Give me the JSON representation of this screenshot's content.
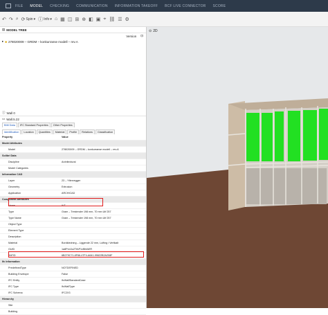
{
  "topbar": {
    "items": [
      {
        "label": "FILE"
      },
      {
        "label": "MODEL"
      },
      {
        "label": "CHECKING"
      },
      {
        "label": "COMMUNICATION"
      },
      {
        "label": "INFORMATION TAKEOFF"
      },
      {
        "label": "BCF LIVE CONNECTOR"
      },
      {
        "label": "SCORE"
      }
    ],
    "active": "MODEL"
  },
  "toolbar": {
    "spin_label": "Spin",
    "info_label": "Info"
  },
  "model_tree": {
    "title": "MODEL TREE",
    "column_header": "Version",
    "file_name": "278020009 – GRDM – konkurranse modell – rev.A"
  },
  "view_2d": {
    "label": "2D"
  },
  "props": {
    "header_label": "Wall 0",
    "title": "Wall.5.22",
    "tabs": [
      "BIM Data",
      "IFC Standard Properties",
      "Other Properties"
    ],
    "subtabs": [
      "Identification",
      "Location",
      "Quantities",
      "Material",
      "Profile",
      "Relations",
      "Classification"
    ],
    "col_property": "Property",
    "col_value": "Value"
  },
  "rows": [
    {
      "k": "Model Attributes",
      "v": "",
      "type": "sec"
    },
    {
      "k": "Model",
      "v": "278020009 – GRDM – konkurranse modell – rev.A",
      "type": "row"
    },
    {
      "k": "Solibri Data",
      "v": "",
      "type": "sec"
    },
    {
      "k": "Discipline",
      "v": "Architectural",
      "type": "row"
    },
    {
      "k": "Model Categories",
      "v": "",
      "type": "row"
    },
    {
      "k": "Information CAD",
      "v": "",
      "type": "sec"
    },
    {
      "k": "Layer",
      "v": "23 – Yttervegger",
      "type": "row"
    },
    {
      "k": "Geometry",
      "v": "Extrusion",
      "type": "row"
    },
    {
      "k": "Application",
      "v": "ARCHICAD",
      "type": "row"
    },
    {
      "k": "Component Attributes",
      "v": "",
      "type": "sec"
    },
    {
      "k": "Name",
      "v": "IVT-",
      "type": "row"
    },
    {
      "k": "Type",
      "v": "Gram – Trestender 198 mm, 70 mm Utf 257",
      "type": "row"
    },
    {
      "k": "Type Name",
      "v": "Gram – Trestender 198 mm, 70 mm Utf 257",
      "type": "row"
    },
    {
      "k": "Object Type",
      "v": "",
      "type": "row"
    },
    {
      "k": "Element Type",
      "v": "",
      "type": "row"
    },
    {
      "k": "Description",
      "v": "",
      "type": "row"
    },
    {
      "k": "Material",
      "v": "Bordkledning – Liggende 22 mm, Lufting i Vertikalt",
      "type": "row"
    },
    {
      "k": "GUID",
      "v": "1a8Pnn3u2TfAP1xBMAER",
      "type": "row"
    },
    {
      "k": "BATID",
      "v": "6B279C71-8F66-47F4-A641-99622B2A208F",
      "type": "row"
    },
    {
      "k": "Ifc Information",
      "v": "",
      "type": "sec"
    },
    {
      "k": "PredefinedType",
      "v": "NOTDEFINED",
      "type": "row"
    },
    {
      "k": "Building Envelope",
      "v": "False",
      "type": "row"
    },
    {
      "k": "IFC Entity",
      "v": "IfcWallStandardCase",
      "type": "row"
    },
    {
      "k": "IFC Type",
      "v": "IfcWallType",
      "type": "row"
    },
    {
      "k": "IFC Schema",
      "v": "IFC2X3",
      "type": "row"
    },
    {
      "k": "Hierarchy",
      "v": "",
      "type": "sec"
    },
    {
      "k": "Site",
      "v": "",
      "type": "row"
    },
    {
      "k": "Building",
      "v": "",
      "type": "row"
    }
  ],
  "colors": {
    "topbar": "#2d3a4a",
    "highlight": "#e11b1b",
    "green": "#22e022",
    "sky": "#e6e8ea",
    "ground": "#6e4734"
  }
}
